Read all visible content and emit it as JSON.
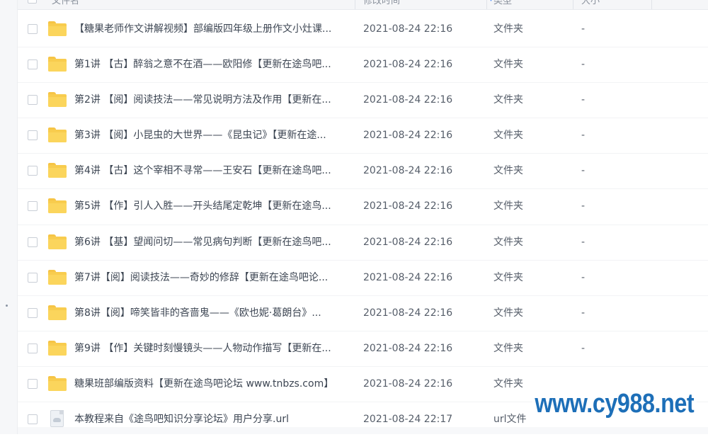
{
  "header": {
    "name_label": "文件名",
    "date_label": "修改时间",
    "type_label": "类型",
    "size_label": "大小"
  },
  "rows": [
    {
      "name": "【糖果老师作文讲解视频】部编版四年级上册作文小灶课...",
      "date": "2021-08-24 22:16",
      "type": "文件夹",
      "size": "-",
      "icon": "folder-icon"
    },
    {
      "name": "第1讲 【古】醉翁之意不在酒——欧阳修【更新在途鸟吧...",
      "date": "2021-08-24 22:16",
      "type": "文件夹",
      "size": "-",
      "icon": "folder-icon"
    },
    {
      "name": "第2讲 【阅】阅读技法——常见说明方法及作用【更新在...",
      "date": "2021-08-24 22:16",
      "type": "文件夹",
      "size": "-",
      "icon": "folder-icon"
    },
    {
      "name": "第3讲 【阅】小昆虫的大世界——《昆虫记》【更新在途...",
      "date": "2021-08-24 22:16",
      "type": "文件夹",
      "size": "-",
      "icon": "folder-icon"
    },
    {
      "name": "第4讲 【古】这个宰相不寻常——王安石【更新在途鸟吧...",
      "date": "2021-08-24 22:16",
      "type": "文件夹",
      "size": "-",
      "icon": "folder-icon"
    },
    {
      "name": "第5讲 【作】引人入胜——开头结尾定乾坤【更新在途鸟...",
      "date": "2021-08-24 22:16",
      "type": "文件夹",
      "size": "-",
      "icon": "folder-icon"
    },
    {
      "name": "第6讲 【基】望闻问切——常见病句判断【更新在途鸟吧...",
      "date": "2021-08-24 22:16",
      "type": "文件夹",
      "size": "-",
      "icon": "folder-icon"
    },
    {
      "name": "第7讲【阅】阅读技法——奇妙的修辞【更新在途鸟吧论...",
      "date": "2021-08-24 22:16",
      "type": "文件夹",
      "size": "-",
      "icon": "folder-icon"
    },
    {
      "name": "第8讲【阅】啼笑皆非的吝啬鬼——《欧也妮·葛朗台》...",
      "date": "2021-08-24 22:16",
      "type": "文件夹",
      "size": "-",
      "icon": "folder-icon"
    },
    {
      "name": "第9讲 【作】关键时刻慢镜头——人物动作描写【更新在...",
      "date": "2021-08-24 22:16",
      "type": "文件夹",
      "size": "-",
      "icon": "folder-icon"
    },
    {
      "name": "糖果班部编版资料【更新在途鸟吧论坛 www.tnbzs.com】",
      "date": "2021-08-24 22:16",
      "type": "文件夹",
      "size": "",
      "icon": "folder-icon"
    },
    {
      "name": "本教程来自《途鸟吧知识分享论坛》用户分享.url",
      "date": "2021-08-24 22:17",
      "type": "url文件",
      "size": "",
      "icon": "url-file-icon"
    }
  ],
  "watermark": {
    "text": "www.cy988.net",
    "color": "#1d6fb8"
  },
  "colors": {
    "folder": "#f8cc4e",
    "accent": "#3b82f6"
  }
}
